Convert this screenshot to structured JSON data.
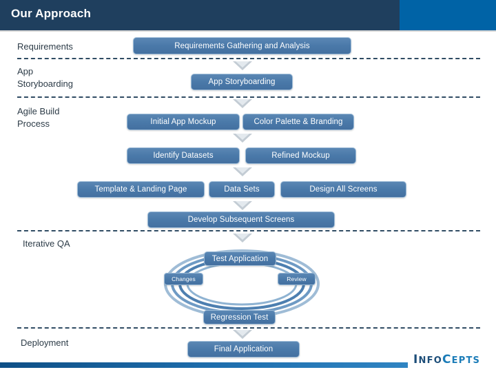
{
  "header": {
    "title": "Our Approach",
    "band_color": "#1f3f5e",
    "accent_color": "#0063a6"
  },
  "phases": [
    {
      "id": "requirements",
      "label": "Requirements"
    },
    {
      "id": "app-storyboarding",
      "label": "App\nStoryboarding"
    },
    {
      "id": "agile-build",
      "label": "Agile Build\nProcess"
    },
    {
      "id": "iterative-qa",
      "label": "Iterative QA"
    },
    {
      "id": "deployment",
      "label": "Deployment"
    }
  ],
  "steps": {
    "requirements_gathering": "Requirements Gathering and Analysis",
    "app_storyboarding": "App Storyboarding",
    "initial_app_mockup": "Initial App Mockup",
    "color_palette_branding": "Color Palette & Branding",
    "identify_datasets": "Identify Datasets",
    "refined_mockup": "Refined Mockup",
    "template_landing_page": "Template & Landing Page",
    "data_sets": "Data Sets",
    "design_all_screens": "Design All Screens",
    "develop_subsequent_screens": "Develop Subsequent Screens",
    "test_application": "Test Application",
    "changes": "Changes",
    "review": "Review",
    "regression_test": "Regression Test",
    "final_application": "Final Application"
  },
  "footer": {
    "logo_part1": "I",
    "logo_part2": "NFO",
    "logo_part3": "C",
    "logo_part4": "EPTS",
    "bar_color": "#1f6fae"
  },
  "colors": {
    "box_fill": "#4a79a9",
    "box_border": "#9dbcd8",
    "separator": "#2f4b63",
    "arrow": "#c3ccd4",
    "ring": "#5b87b4",
    "text_dark": "#2c3b47"
  }
}
